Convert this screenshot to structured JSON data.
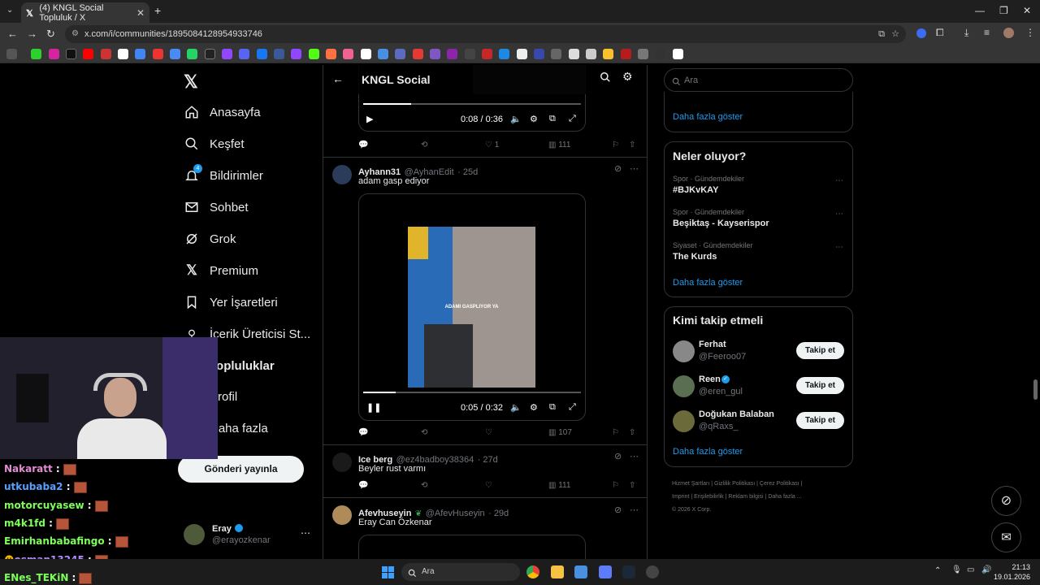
{
  "browser": {
    "tab_title": "(4) KNGL Social Topluluk / X",
    "url": "x.com/i/communities/1895084128954933746"
  },
  "nav": {
    "items": [
      {
        "label": "Anasayfa",
        "icon": "home-icon"
      },
      {
        "label": "Keşfet",
        "icon": "search-icon"
      },
      {
        "label": "Bildirimler",
        "icon": "bell-icon",
        "badge": "4"
      },
      {
        "label": "Sohbet",
        "icon": "mail-icon"
      },
      {
        "label": "Grok",
        "icon": "grok-icon"
      },
      {
        "label": "Premium",
        "icon": "x-logo-icon"
      },
      {
        "label": "Yer İşaretleri",
        "icon": "bookmark-icon"
      },
      {
        "label": "İçerik Üreticisi St...",
        "icon": "creator-icon"
      },
      {
        "label": "Topluluklar",
        "icon": "communities-icon"
      },
      {
        "label": "Profil",
        "icon": "profile-icon"
      },
      {
        "label": "Daha fazla",
        "icon": "more-icon"
      }
    ],
    "post_button": "Gönderi yayınla",
    "account": {
      "name": "Eray",
      "handle": "@erayozkenar"
    }
  },
  "header": {
    "title": "KNGL Social"
  },
  "feed": {
    "video1": {
      "time": "0:08 / 0:36",
      "progress": 0.22,
      "likes": "1",
      "views": "111"
    },
    "post2": {
      "name": "Ayhann31",
      "handle": "@AyhanEdit",
      "age": "· 25d",
      "text": "adam gasp ediyor",
      "video_caption": "ADAMI GASPLIYOR YA",
      "time": "0:05 / 0:32",
      "progress": 0.15,
      "views": "107"
    },
    "post3": {
      "name": "Ice berg",
      "handle": "@ez4badboy38364",
      "age": "· 27d",
      "text": "Beyler rust varmı",
      "views": "111"
    },
    "post4": {
      "name": "Afevhuseyin",
      "handle": "@AfevHuseyin",
      "age": "· 29d",
      "text": "Eray Can Özkenar"
    }
  },
  "search": {
    "placeholder": "Ara"
  },
  "right": {
    "top_partial": "(kaydırılmış içerik)",
    "show_more": "Daha fazla göster",
    "trends_title": "Neler oluyor?",
    "trends": [
      {
        "meta": "Spor · Gündemdekiler",
        "topic": "#BJKvKAY"
      },
      {
        "meta": "Spor · Gündemdekiler",
        "topic": "Beşiktaş - Kayserispor"
      },
      {
        "meta": "Siyaset · Gündemdekiler",
        "topic": "The Kurds"
      }
    ],
    "who_title": "Kimi takip etmeli",
    "who": [
      {
        "name": "Ferhat",
        "handle": "@Feeroo07",
        "verified": false
      },
      {
        "name": "Reen",
        "handle": "@eren_gul",
        "verified": true
      },
      {
        "name": "Doğukan Balaban",
        "handle": "@qRaxs_",
        "verified": false
      }
    ],
    "follow_label": "Takip et",
    "footer": [
      "Hizmet Şartları",
      "Gizlilik Politikası",
      "Çerez Politikası",
      "Imprint",
      "Erişilebilirlik",
      "Reklam bilgisi",
      "Daha fazla ...",
      "© 2026 X Corp."
    ]
  },
  "chat": [
    {
      "user": "Nakaratt",
      "color": "#e38bd3"
    },
    {
      "user": "utkubaba2",
      "color": "#5aa0ff"
    },
    {
      "user": "motorcuyasew",
      "color": "#7dff5a"
    },
    {
      "user": "m4k1fd",
      "color": "#7dff5a"
    },
    {
      "user": "Emirhanbabafingo",
      "color": "#7dff5a"
    },
    {
      "user": "osman13245",
      "color": "#b38cff"
    },
    {
      "user": "ENes_TEKiN",
      "color": "#7dff5a"
    }
  ],
  "taskbar": {
    "search": "Ara",
    "time": "21:13",
    "date": "19.01.2026"
  }
}
